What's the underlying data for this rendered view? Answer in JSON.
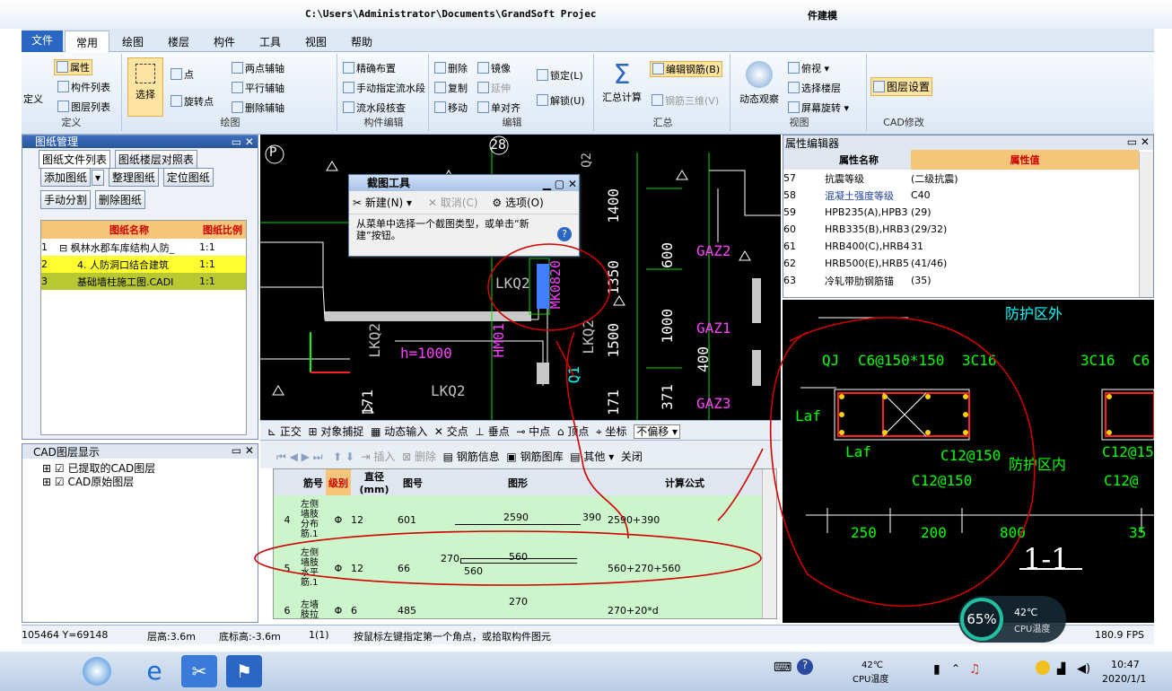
{
  "title": {
    "path": "C:\\Users\\Administrator\\Documents\\GrandSoft Projec",
    "suffix": "件建模"
  },
  "menu": {
    "file": "文件",
    "tabs": [
      "常用",
      "绘图",
      "楼层",
      "构件",
      "工具",
      "视图",
      "帮助"
    ]
  },
  "ribbon": {
    "define": "定义",
    "attr": "属性",
    "comp_list": "构件列表",
    "layer_list": "图层列表",
    "g1": "定义",
    "select": "选择",
    "point": "点",
    "rotpoint": "旋转点",
    "axis2": "两点辅轴",
    "paraxis": "平行辅轴",
    "delaxis": "删除辅轴",
    "g2": "绘图",
    "precise": "精确布置",
    "manual_flow": "手动指定流水段",
    "flow_check": "流水段核查",
    "g3": "构件编辑",
    "del": "删除",
    "mirror": "镜像",
    "copy": "复制",
    "extend": "延伸",
    "move": "移动",
    "align": "单对齐",
    "g4": "编辑",
    "lock": "锁定(L)",
    "unlock": "解锁(U)",
    "sum": "汇总计算",
    "edit_rebar": "编辑钢筋(B)",
    "rebar3d": "钢筋三维(V)",
    "g5": "汇总",
    "dyn": "动态观察",
    "top": "俯视",
    "sel_floor": "选择楼层",
    "screen_rot": "屏幕旋转",
    "g6": "视图",
    "layer_set": "图层设置",
    "g7": "CAD修改"
  },
  "drawing_panel": {
    "title": "图纸管理",
    "tab1": "图纸文件列表",
    "tab2": "图纸楼层对照表",
    "b_add": "添加图纸",
    "b_org": "整理图纸",
    "b_pos": "定位图纸",
    "b_split": "手动分割",
    "b_del": "删除图纸",
    "col_name": "图纸名称",
    "col_scale": "图纸比例",
    "rows": [
      {
        "n": "1",
        "name": "枫林水郡车库结构人防_",
        "scale": "1:1"
      },
      {
        "n": "2",
        "name": "4. 人防洞口结合建筑",
        "scale": "1:1"
      },
      {
        "n": "3",
        "name": "基础墙柱施工图.CADI",
        "scale": "1:1"
      }
    ]
  },
  "cad_layers": {
    "title": "CAD图层显示",
    "items": [
      "已提取的CAD图层",
      "CAD原始图层"
    ]
  },
  "capture": {
    "title": "截图工具",
    "new": "新建(N)",
    "cancel": "取消(C)",
    "options": "选项(O)",
    "msg": "从菜单中选择一个截图类型，或单击“新建”按钮。"
  },
  "snapbar": [
    "正交",
    "对象捕捉",
    "动态输入",
    "交点",
    "垂点",
    "中点",
    "顶点",
    "坐标",
    "不偏移"
  ],
  "rebar_toolbar": [
    "插入",
    "删除",
    "钢筋信息",
    "钢筋图库",
    "其他",
    "关闭"
  ],
  "rebar_table": {
    "headers": [
      "筋号",
      "级别",
      "直径(mm)",
      "图号",
      "图形",
      "计算公式"
    ],
    "rows": [
      {
        "n": "4",
        "name": "左侧墙肢分布筋.1",
        "grade": "Φ",
        "dia": "12",
        "fig": "601",
        "shape1": "2590",
        "shape2": "390",
        "formula": "2590+390"
      },
      {
        "n": "5",
        "name": "左侧墙肢水平筋.1",
        "grade": "Φ",
        "dia": "12",
        "fig": "66",
        "shape1": "560",
        "shape2": "270",
        "shape3": "560",
        "formula": "560+270+560"
      },
      {
        "n": "6",
        "name": "左墙肢拉",
        "grade": "Φ",
        "dia": "6",
        "fig": "485",
        "shape1": "270",
        "formula": "270+20*d"
      }
    ]
  },
  "props": {
    "title": "属性编辑器",
    "col_name": "属性名称",
    "col_val": "属性值",
    "rows": [
      {
        "n": "57",
        "name": "抗震等级",
        "val": "(二级抗震)"
      },
      {
        "n": "58",
        "name": "混凝土强度等级",
        "val": "C40"
      },
      {
        "n": "59",
        "name": "HPB235(A),HPB3",
        "val": "(29)"
      },
      {
        "n": "60",
        "name": "HRB335(B),HRB3",
        "val": "(29/32)"
      },
      {
        "n": "61",
        "name": "HRB400(C),HRB4",
        "val": "31"
      },
      {
        "n": "62",
        "name": "HRB500(E),HRB5",
        "val": "(41/46)"
      },
      {
        "n": "63",
        "name": "冷轧带肋钢筋锚",
        "val": "(35)"
      }
    ]
  },
  "cad_main": {
    "labels": [
      "28",
      "P",
      "LKQ2",
      "MK0820",
      "LKQ2",
      "h=1000",
      "HM01",
      "Q1",
      "LKQ2",
      "LKQ2",
      "1400",
      "1350",
      "1500",
      "600",
      "1000",
      "400",
      "171",
      "171",
      "371",
      "GAZ2",
      "GAZ1",
      "GAZ3",
      "Q2"
    ]
  },
  "detail": {
    "labels": [
      "防护区外",
      "QJ",
      "C6@150*150",
      "3C16",
      "3C16",
      "C6",
      "Laf",
      "Laf",
      "C12@150",
      "C12@150",
      "防护区内",
      "C12@150",
      "C12@",
      "250",
      "200",
      "800",
      "35",
      "1-1"
    ]
  },
  "status": {
    "coords": "105464 Y=69148",
    "floor_h": "层高:3.6m",
    "base_h": "底标高:-3.6m",
    "count": "1(1)",
    "hint": "按鼠标左键指定第一个角点，或拾取构件图元",
    "fps": "180.9 FPS"
  },
  "cpu": {
    "pct": "65%",
    "temp": "42℃",
    "label": "CPU温度"
  },
  "taskbar": {
    "temp": "42℃",
    "cpu": "CPU温度",
    "time": "10:47",
    "date": "2020/1/1"
  }
}
